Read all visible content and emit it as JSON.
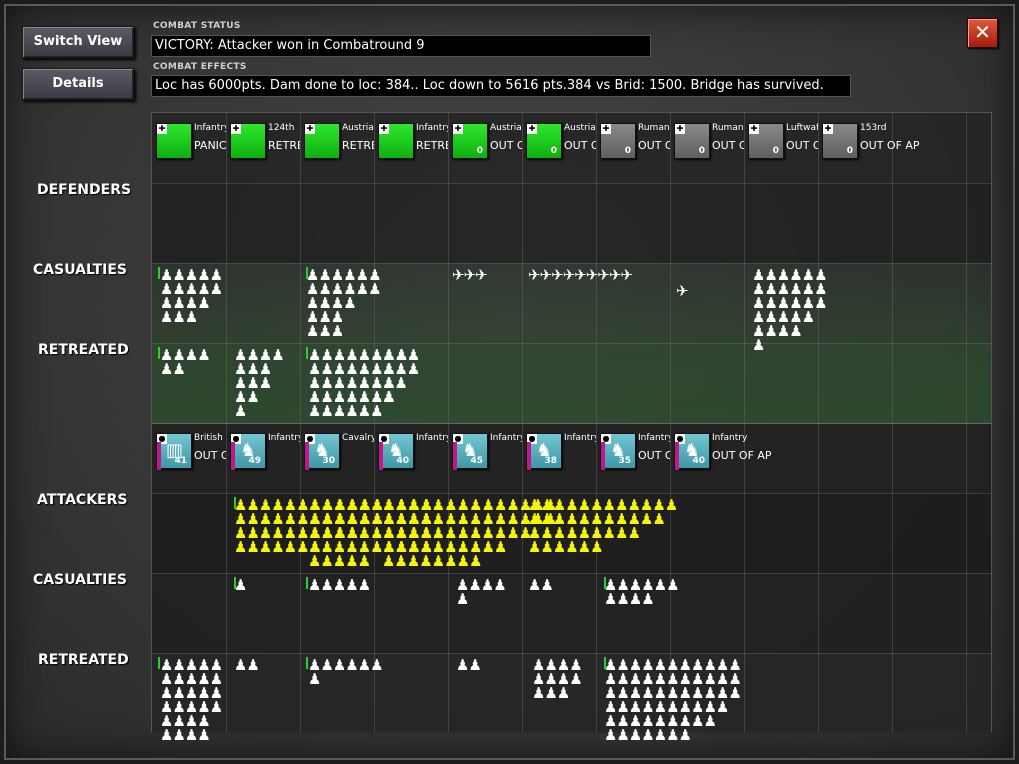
{
  "toolbar": {
    "switch_view": "Switch View",
    "details": "Details",
    "close": "✕"
  },
  "combat_status": {
    "label": "COMBAT STATUS",
    "text": "VICTORY: Attacker won in Combatround  9"
  },
  "combat_effects": {
    "label": "COMBAT EFFECTS",
    "text": "Loc has  6000pts. Dam done to loc: 384.. Loc down to 5616 pts.384 vs Brid: 1500. Bridge has survived."
  },
  "row_labels": {
    "defenders": "DEFENDERS",
    "def_casualties": "CASUALTIES",
    "def_retreated": "RETREATED",
    "attackers": "ATTACKERS",
    "att_casualties": "CASUALTIES",
    "att_retreated": "RETREATED"
  },
  "colors": {
    "defender_chip": "#1fcc1f",
    "defender_grey": "#737373",
    "attacker_chip": "#5ab3c0",
    "accent_green": "#2bd12b",
    "attacker_yellow": "#f5f50a"
  },
  "defender_units": [
    {
      "name": "Infantry",
      "status": "PANIC",
      "num": "",
      "color": "green",
      "icon": "cross-flag-icon"
    },
    {
      "name": "124th",
      "status": "RETREAT",
      "num": "",
      "color": "green",
      "icon": "cross-flag-icon"
    },
    {
      "name": "Austrian",
      "status": "RETREAT",
      "num": "",
      "color": "green",
      "icon": "cross-flag-icon"
    },
    {
      "name": "Infantry",
      "status": "RETREAT",
      "num": "",
      "color": "green",
      "icon": "cross-flag-icon"
    },
    {
      "name": "Austrian",
      "status": "OUT OF AP",
      "num": "0",
      "color": "green",
      "icon": "cross-flag-icon"
    },
    {
      "name": "Austrian",
      "status": "OUT OF AP",
      "num": "0",
      "color": "green",
      "icon": "cross-flag-icon"
    },
    {
      "name": "Rumanian",
      "status": "OUT OF AP",
      "num": "0",
      "color": "grey",
      "icon": "iron-cross-icon"
    },
    {
      "name": "Rumanian",
      "status": "OUT OF AP",
      "num": "0",
      "color": "grey",
      "icon": "iron-cross-icon"
    },
    {
      "name": "Luftwaffe",
      "status": "OUT OF AP",
      "num": "0",
      "color": "grey",
      "icon": "iron-cross-icon"
    },
    {
      "name": "153rd",
      "status": "OUT OF AP",
      "num": "0",
      "color": "grey",
      "icon": "iron-cross-icon"
    }
  ],
  "attacker_units": [
    {
      "name": "British",
      "status": "OUT OF AP",
      "num": "41",
      "icon": "french-flag-icon"
    },
    {
      "name": "Infantry",
      "status": "",
      "num": "49",
      "icon": "soldier-icon"
    },
    {
      "name": "Cavalry",
      "status": "",
      "num": "30",
      "icon": "cavalry-icon"
    },
    {
      "name": "Infantry",
      "status": "",
      "num": "40",
      "icon": "soldier-icon"
    },
    {
      "name": "Infantry",
      "status": "",
      "num": "45",
      "icon": "soldier-icon"
    },
    {
      "name": "Infantry",
      "status": "",
      "num": "38",
      "icon": "soldier-icon"
    },
    {
      "name": "Infantry",
      "status": "OUT OF AP",
      "num": "35",
      "icon": "soldier-icon"
    },
    {
      "name": "Infantry",
      "status": "OUT OF AP",
      "num": "40",
      "icon": "soldier-icon"
    }
  ]
}
